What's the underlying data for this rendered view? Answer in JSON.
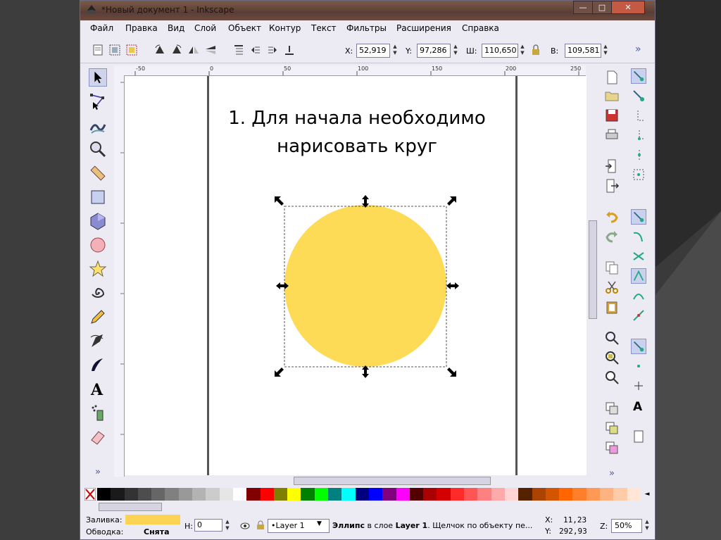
{
  "window": {
    "title": "*Новый документ 1 - Inkscape",
    "min_label": "—",
    "max_label": "□",
    "close_label": "✕"
  },
  "menu": [
    "Файл",
    "Правка",
    "Вид",
    "Слой",
    "Объект",
    "Контур",
    "Текст",
    "Фильтры",
    "Расширения",
    "Справка"
  ],
  "toolbar": {
    "x_label": "X:",
    "x_value": "52,919",
    "y_label": "Y:",
    "y_value": "97,286",
    "w_label": "Ш:",
    "w_value": "110,650",
    "h_label": "В:",
    "h_value": "109,581",
    "more": "»"
  },
  "ruler": {
    "ticks": [
      "-50",
      "0",
      "50",
      "100",
      "150",
      "200",
      "250"
    ]
  },
  "canvas": {
    "heading": "1. Для начала необходимо\nнарисовать круг",
    "circle_color": "#fedb56"
  },
  "palette": [
    "#000000",
    "#1a1a1a",
    "#333333",
    "#4d4d4d",
    "#666666",
    "#808080",
    "#999999",
    "#b3b3b3",
    "#cccccc",
    "#e6e6e6",
    "#ffffff",
    "#800000",
    "#ff0000",
    "#808000",
    "#ffff00",
    "#008000",
    "#00ff00",
    "#008080",
    "#00ffff",
    "#000080",
    "#0000ff",
    "#800080",
    "#ff00ff",
    "#550000",
    "#aa0000",
    "#d40000",
    "#ff2a2a",
    "#ff5555",
    "#ff8080",
    "#ffaaaa",
    "#ffd5d5",
    "#552200",
    "#aa4400",
    "#d45500",
    "#ff6600",
    "#ff7f2a",
    "#ff9955",
    "#ffb380",
    "#ffccaa",
    "#ffe6d5"
  ],
  "status": {
    "fill_label": "Заливка:",
    "fill_color": "#fcd353",
    "stroke_label": "Обводка:",
    "stroke_value": "Снята",
    "h_label": "H:",
    "h_value": "0",
    "layer": "•Layer 1",
    "message_prefix": "Эллипс",
    "message_mid": " в слое ",
    "message_layer": "Layer 1",
    "message_rest": ". Щелчок по объекту пе...",
    "x_label": "X:",
    "x_value": "11,23",
    "y_label": "Y:",
    "y_value": "292,93",
    "zoom_label": "Z:",
    "zoom_value": "50%",
    "dropdown": "▼"
  }
}
